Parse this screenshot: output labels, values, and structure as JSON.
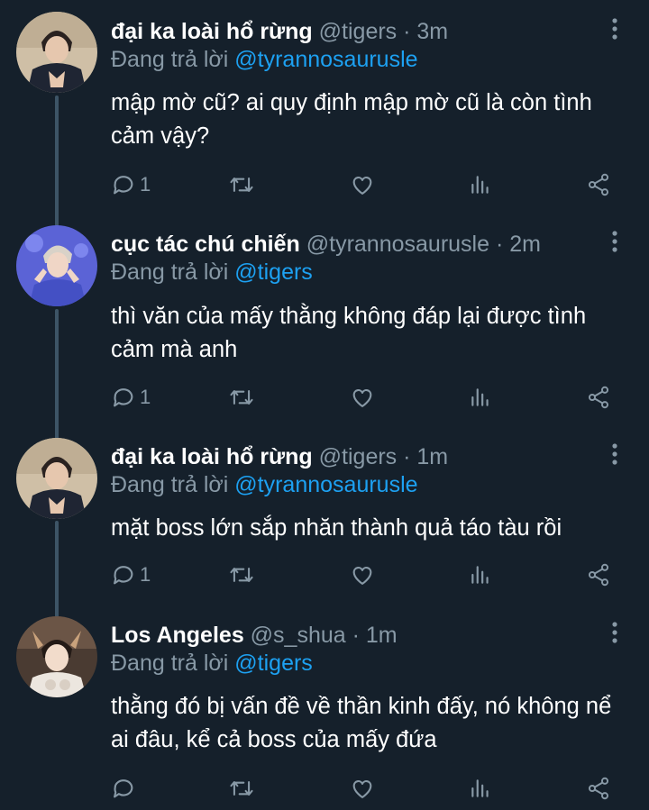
{
  "colors": {
    "background": "#15202b",
    "secondary_text": "#8899a6",
    "mention": "#1da1f2",
    "thread_line": "#3d5466"
  },
  "tweets": [
    {
      "display_name": "đại ka loài hổ rừng",
      "meta": "@tigers · 3m",
      "reply_prefix": "Đang trả lời ",
      "reply_to": "@tyrannosaurusle",
      "text": "mập mờ cũ? ai quy định mập mờ cũ là còn tình cảm vậy?",
      "reply_count": "1",
      "avatar_icon": "avatar-photo"
    },
    {
      "display_name": "cục tác chú chiến",
      "meta": "@tyrannosaurusle · 2m",
      "reply_prefix": "Đang trả lời ",
      "reply_to": "@tigers",
      "text": "thì văn của mấy thằng không đáp lại được tình cảm mà anh",
      "reply_count": "1",
      "avatar_icon": "avatar-photo"
    },
    {
      "display_name": "đại ka loài hổ rừng",
      "meta": "@tigers · 1m",
      "reply_prefix": "Đang trả lời ",
      "reply_to": "@tyrannosaurusle",
      "text": "mặt boss lớn sắp nhăn thành quả táo tàu rồi",
      "reply_count": "1",
      "avatar_icon": "avatar-photo"
    },
    {
      "display_name": "Los Angeles",
      "meta": "@s_shua · 1m",
      "reply_prefix": "Đang trả lời ",
      "reply_to": "@tigers",
      "text": "thằng đó bị vấn đề về thần kinh đấy, nó không nể ai đâu, kể cả boss của mấy đứa",
      "reply_count": "",
      "avatar_icon": "avatar-photo"
    }
  ],
  "action_icons": [
    "reply-icon",
    "retweet-icon",
    "like-icon",
    "stats-icon",
    "share-icon"
  ]
}
